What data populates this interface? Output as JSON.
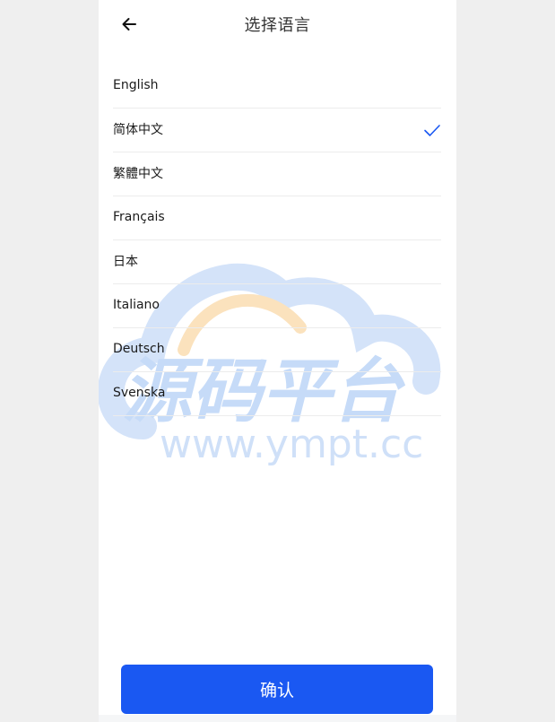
{
  "header": {
    "title": "选择语言",
    "back_icon": "arrow-left-icon"
  },
  "languages": [
    {
      "label": "English",
      "selected": false
    },
    {
      "label": "简体中文",
      "selected": true
    },
    {
      "label": "繁體中文",
      "selected": false
    },
    {
      "label": "Français",
      "selected": false
    },
    {
      "label": "日本",
      "selected": false
    },
    {
      "label": "Italiano",
      "selected": false
    },
    {
      "label": "Deutsch",
      "selected": false
    },
    {
      "label": "Svenska",
      "selected": false
    }
  ],
  "watermark": {
    "brand": "源码平台",
    "url": "www.ympt.cc"
  },
  "footer": {
    "confirm_label": "确认"
  },
  "colors": {
    "accent": "#1a58f2",
    "check": "#1a58f2",
    "watermark_blue": "#c9dcf8",
    "watermark_orange": "#fbe2bd"
  }
}
